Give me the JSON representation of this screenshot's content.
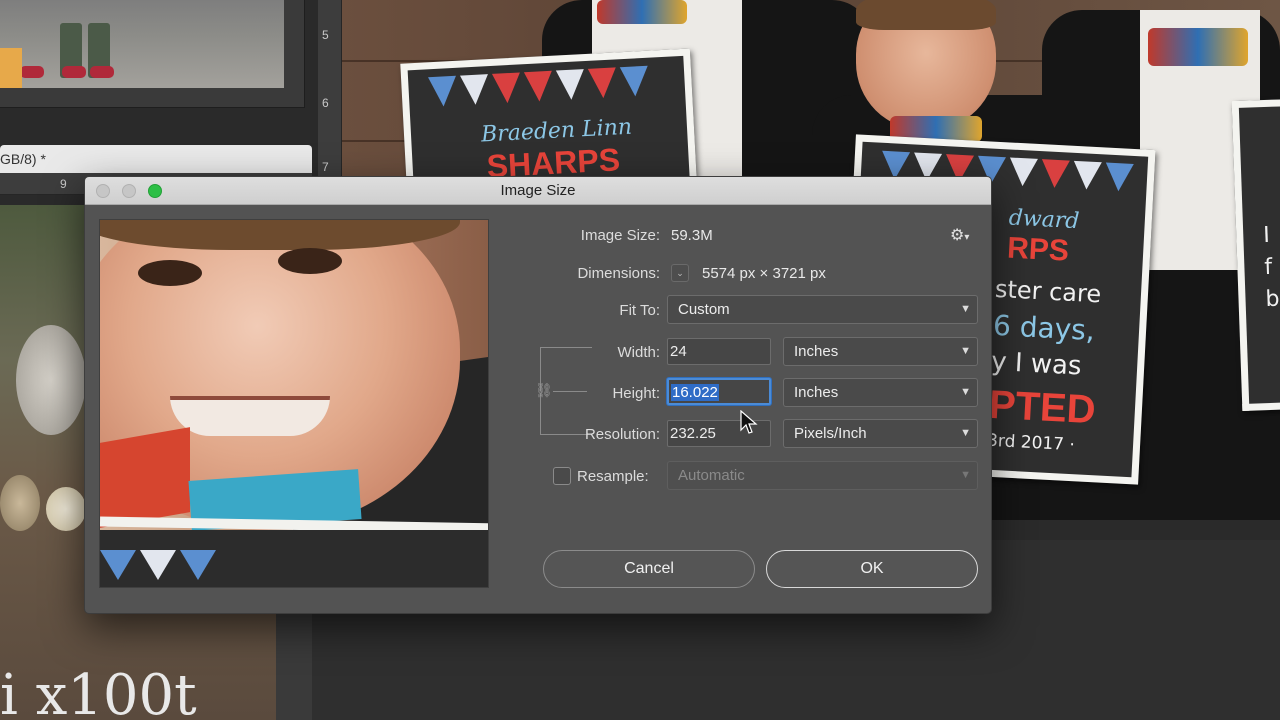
{
  "background": {
    "left_doc_tab_title": "GB/8) *",
    "left_doc_watermark": "i x100t",
    "vertical_ruler_ticks": [
      "5",
      "6",
      "7"
    ],
    "horizontal_ruler_tick": "9",
    "sign1": {
      "script_line": "Braeden Linn",
      "big_line": "SHARPS"
    },
    "sign2": {
      "script_line": "dward",
      "big_line": "RPS",
      "line1": "ster care",
      "line2": "6 days,",
      "line3": "y I was",
      "line4": "PTED",
      "line5": "3rd 2017 ·"
    },
    "sign3": {
      "line1": "I",
      "line2": "f",
      "line3": "b"
    }
  },
  "dialog": {
    "title": "Image Size",
    "image_size_label": "Image Size:",
    "image_size_value": "59.3M",
    "dimensions_label": "Dimensions:",
    "dimensions_value": "5574 px  ×  3721 px",
    "fit_to_label": "Fit To:",
    "fit_to_value": "Custom",
    "width_label": "Width:",
    "width_value": "24",
    "width_unit": "Inches",
    "height_label": "Height:",
    "height_value": "16.022",
    "height_unit": "Inches",
    "resolution_label": "Resolution:",
    "resolution_value": "232.25",
    "resolution_unit": "Pixels/Inch",
    "resample_label": "Resample:",
    "resample_value": "Automatic",
    "resample_checked": false,
    "cancel_label": "Cancel",
    "ok_label": "OK",
    "gear_icon": "gear-icon",
    "accent_color": "#2f6cc6",
    "focus_ring_color": "#4b8bd6",
    "maximize_button_color": "#2dbf46"
  }
}
